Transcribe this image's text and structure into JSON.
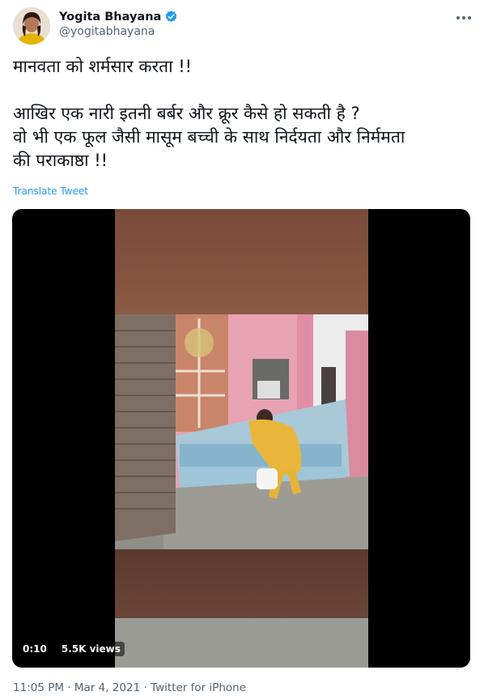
{
  "author": {
    "name": "Yogita Bhayana",
    "handle": "@yogitabhayana",
    "verified": true
  },
  "icons": {
    "avatar": "avatar",
    "verified": "verified-badge-icon",
    "more": "more-options-icon"
  },
  "tweet": {
    "line1": "मानवता को शर्मसार करता !!",
    "line2": "आखिर एक नारी इतनी बर्बर और क्रूर कैसे हो सकती है ?",
    "line3": "वो भी एक फूल जैसी मासूम बच्ची के साथ निर्दयता और निर्ममता",
    "line4": "की पराकाष्ठा !!",
    "translate_label": "Translate Tweet"
  },
  "video": {
    "time": "0:10",
    "views": "5.5K views"
  },
  "footer": {
    "time": "11:05 PM",
    "sep1": "·",
    "date": "Mar 4, 2021",
    "sep2": "·",
    "source": "Twitter for iPhone"
  },
  "colors": {
    "link_blue": "#1d9bf0",
    "muted_text": "#536471",
    "body_text": "#0f1419"
  }
}
